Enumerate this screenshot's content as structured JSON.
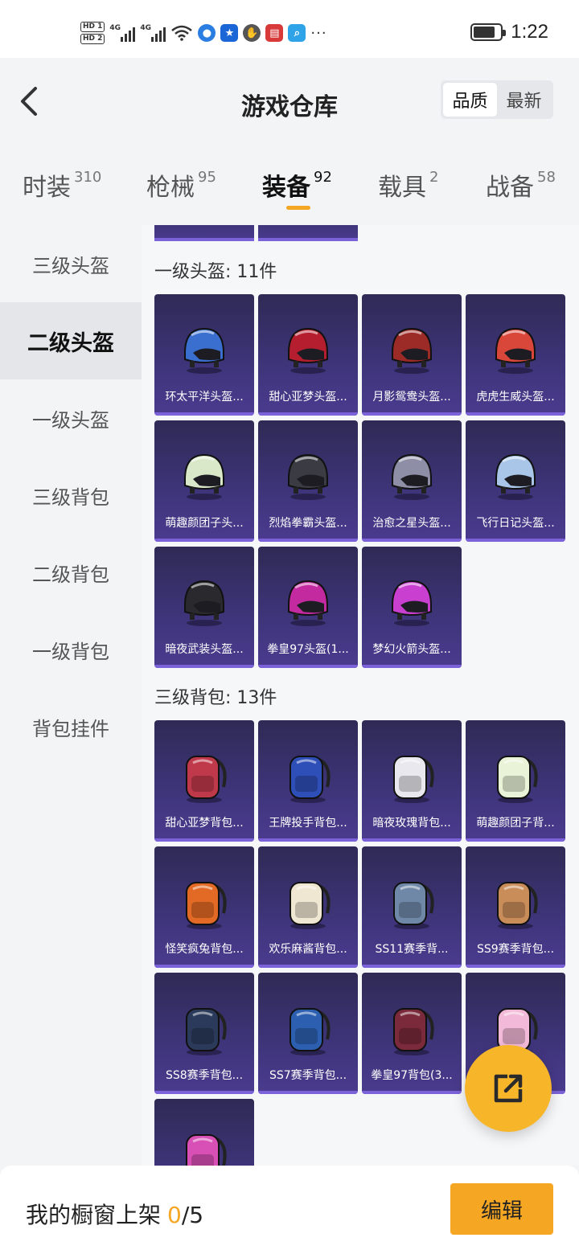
{
  "status_bar": {
    "hd1": "HD 1",
    "hd2": "HD 2",
    "net1": "4G",
    "net2": "4G",
    "more": "···",
    "time": "1:22"
  },
  "header": {
    "title": "游戏仓库",
    "sort_options": [
      "品质",
      "最新"
    ],
    "sort_selected": "品质"
  },
  "tabs": [
    {
      "label": "时装",
      "count": "310"
    },
    {
      "label": "枪械",
      "count": "95"
    },
    {
      "label": "装备",
      "count": "92",
      "active": true
    },
    {
      "label": "载具",
      "count": "2"
    },
    {
      "label": "战备",
      "count": "58"
    }
  ],
  "sidebar": {
    "items": [
      "三级头盔",
      "二级头盔",
      "一级头盔",
      "三级背包",
      "二级背包",
      "一级背包",
      "背包挂件"
    ],
    "active": "二级头盔"
  },
  "sections": [
    {
      "title": "一级头盔: 11件",
      "items": [
        {
          "name": "环太平洋头盔...",
          "icon": "helmet-icon",
          "color": "#3a6fd0"
        },
        {
          "name": "甜心亚梦头盔...",
          "icon": "helmet-icon",
          "color": "#b51e2e"
        },
        {
          "name": "月影鸳鸯头盔...",
          "icon": "helmet-icon",
          "color": "#9c2b28"
        },
        {
          "name": "虎虎生威头盔...",
          "icon": "helmet-icon",
          "color": "#d9463a"
        },
        {
          "name": "萌趣颜团子头...",
          "icon": "helmet-icon",
          "color": "#d9e8c9"
        },
        {
          "name": "烈焰拳霸头盔...",
          "icon": "helmet-icon",
          "color": "#3b3b44"
        },
        {
          "name": "治愈之星头盔...",
          "icon": "helmet-icon",
          "color": "#8e8ea6"
        },
        {
          "name": "飞行日记头盔...",
          "icon": "helmet-icon",
          "color": "#a9c5e8"
        },
        {
          "name": "暗夜武装头盔...",
          "icon": "helmet-icon",
          "color": "#2a2a2e"
        },
        {
          "name": "拳皇97头盔(1...",
          "icon": "helmet-icon",
          "color": "#c42aa0"
        },
        {
          "name": "梦幻火箭头盔...",
          "icon": "helmet-icon",
          "color": "#c93fd0"
        }
      ]
    },
    {
      "title": "三级背包: 13件",
      "items": [
        {
          "name": "甜心亚梦背包...",
          "icon": "backpack-icon",
          "color": "#c0394a"
        },
        {
          "name": "王牌投手背包...",
          "icon": "backpack-icon",
          "color": "#2f4fb8"
        },
        {
          "name": "暗夜玫瑰背包...",
          "icon": "backpack-icon",
          "color": "#e8e8ee"
        },
        {
          "name": "萌趣颜团子背...",
          "icon": "backpack-icon",
          "color": "#e9f3d8"
        },
        {
          "name": "怪笑疯兔背包...",
          "icon": "backpack-icon",
          "color": "#e36a24"
        },
        {
          "name": "欢乐麻酱背包...",
          "icon": "backpack-icon",
          "color": "#f0e7d2"
        },
        {
          "name": "SS11赛季背...",
          "icon": "backpack-icon",
          "color": "#6f88a8"
        },
        {
          "name": "SS9赛季背包...",
          "icon": "backpack-icon",
          "color": "#c98d5a"
        },
        {
          "name": "SS8赛季背包...",
          "icon": "backpack-icon",
          "color": "#2b3a5a"
        },
        {
          "name": "SS7赛季背包...",
          "icon": "backpack-icon",
          "color": "#2d5fb0"
        },
        {
          "name": "拳皇97背包(3...",
          "icon": "backpack-icon",
          "color": "#7a2a3a"
        },
        {
          "name": "",
          "icon": "backpack-icon",
          "color": "#f2b9d8"
        },
        {
          "name": "",
          "icon": "backpack-icon",
          "color": "#d84fb5"
        }
      ]
    }
  ],
  "fab_icon": "share-icon",
  "bottom_bar": {
    "label": "我的橱窗上架",
    "current": "0",
    "total": "/5",
    "edit_label": "编辑"
  },
  "colors": {
    "accent": "#f5a623",
    "card_bg": "#3d3478"
  }
}
